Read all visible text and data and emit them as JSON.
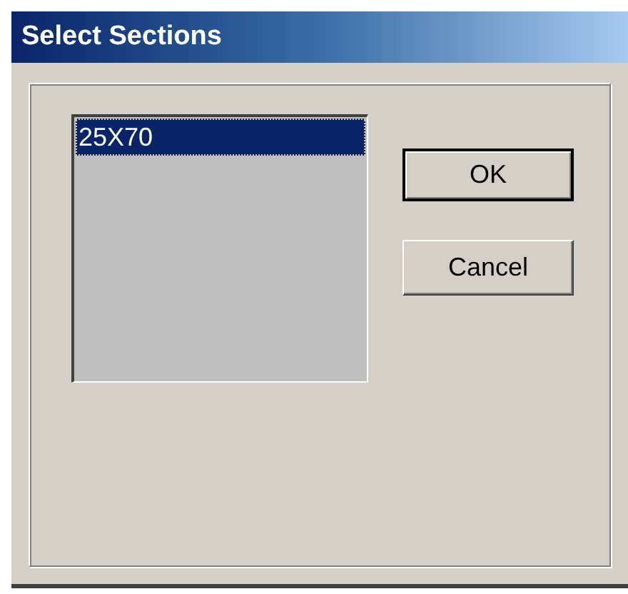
{
  "window": {
    "title": "Select Sections"
  },
  "list": {
    "items": [
      {
        "label": "25X70",
        "selected": true
      }
    ]
  },
  "buttons": [
    {
      "label": "OK",
      "default": true
    },
    {
      "label": "Cancel",
      "default": false
    }
  ]
}
